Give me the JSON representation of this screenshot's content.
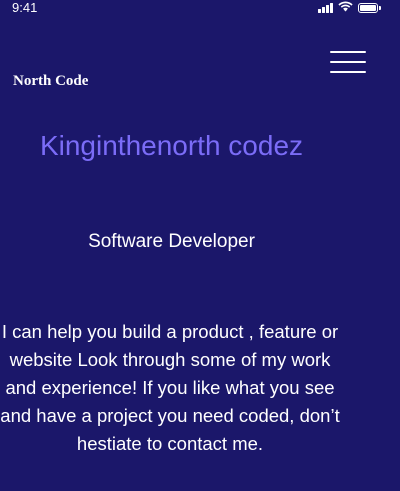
{
  "status_bar": {
    "time": "9:41",
    "icons": [
      "signal-icon",
      "wifi-icon",
      "battery-icon"
    ]
  },
  "navbar": {
    "brand": "North Code",
    "menu_icon": "hamburger-menu-icon"
  },
  "hero": {
    "title": "Kinginthenorth codez",
    "subtitle": "Software Developer",
    "description": "I can help you build a product , feature or website Look through some of my work and experience! If you like what you see and have a project you need coded, don’t hestiate to contact me."
  },
  "colors": {
    "background": "#1b176a",
    "accent": "#7b6cf7",
    "text": "#ffffff"
  }
}
